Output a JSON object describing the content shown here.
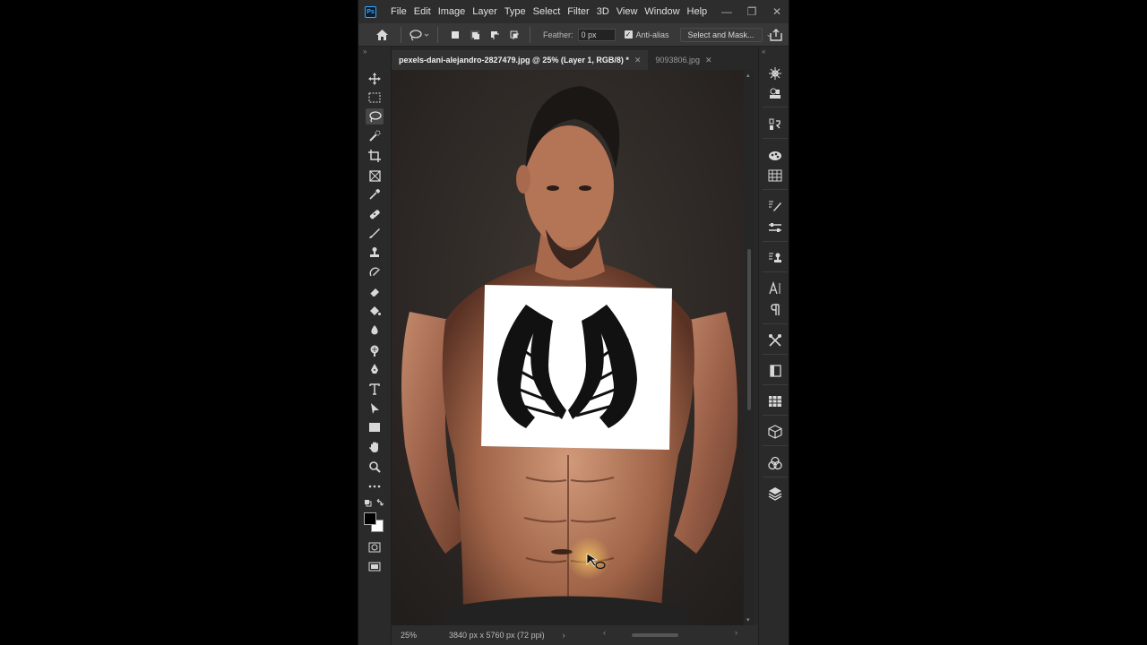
{
  "app": {
    "logo_text": "Ps"
  },
  "menu": [
    "File",
    "Edit",
    "Image",
    "Layer",
    "Type",
    "Select",
    "Filter",
    "3D",
    "View",
    "Window",
    "Help"
  ],
  "window_controls": {
    "minimize": "—",
    "restore": "❐",
    "close": "✕"
  },
  "options": {
    "feather_label": "Feather:",
    "feather_value": "0 px",
    "antialias_label": "Anti-alias",
    "antialias_checked": true,
    "select_and_mask": "Select and Mask..."
  },
  "tabs": [
    {
      "label": "pexels-dani-alejandro-2827479.jpg @ 25% (Layer 1, RGB/8) *",
      "close": "✕",
      "active": true
    },
    {
      "label": "9093806.jpg",
      "close": "✕",
      "active": false
    }
  ],
  "status": {
    "zoom": "25%",
    "doc_size": "3840 px x 5760 px (72 ppi)",
    "arrow": "›"
  },
  "colors": {
    "foreground": "#000000",
    "background": "#ffffff",
    "accent": "#31a8ff"
  },
  "tools": [
    "move-icon",
    "marquee-icon",
    "lasso-icon",
    "quick-select-icon",
    "crop-icon",
    "frame-icon",
    "eyedropper-icon",
    "healing-icon",
    "brush-icon",
    "stamp-icon",
    "history-brush-icon",
    "eraser-icon",
    "paint-bucket-icon",
    "blur-icon",
    "dodge-icon",
    "pen-icon",
    "type-icon",
    "path-select-icon",
    "rectangle-icon",
    "hand-icon",
    "zoom-icon",
    "more-tools-icon"
  ],
  "right_panels": [
    "navigator-icon",
    "histogram-icon",
    "info-icon",
    "color-icon",
    "swatches-icon",
    "brushes-icon",
    "adjustments-icon",
    "clone-source-icon",
    "character-icon",
    "paragraph-icon",
    "tools-preset-icon",
    "libraries-icon",
    "table-icon",
    "3d-icon",
    "channels-icon",
    "layers-icon"
  ]
}
